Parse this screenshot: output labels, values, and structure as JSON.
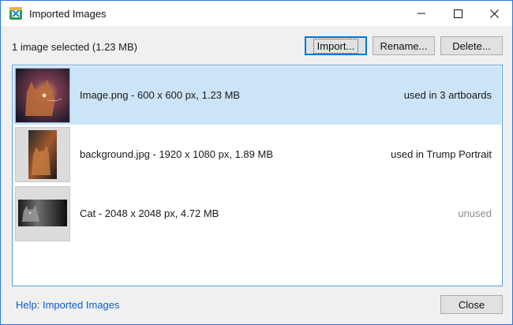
{
  "window": {
    "title": "Imported Images"
  },
  "toolbar": {
    "selection_info": "1 image selected (1.23 MB)",
    "import_label": "Import...",
    "rename_label": "Rename...",
    "delete_label": "Delete..."
  },
  "images": [
    {
      "label": "Image.png - 600 x 600 px, 1.23 MB",
      "usage": "used in 3 artboards",
      "selected": true,
      "thumbnail": "cat-photo-icon"
    },
    {
      "label": "background.jpg - 1920 x 1080 px, 1.89 MB",
      "usage": "used in Trump Portrait",
      "selected": false,
      "thumbnail": "cat-photo-icon"
    },
    {
      "label": "Cat - 2048 x 2048 px, 4.72 MB",
      "usage": "unused",
      "selected": false,
      "thumbnail": "cat-photo-icon"
    }
  ],
  "footer": {
    "help_link": "Help: Imported Images",
    "close_label": "Close"
  },
  "colors": {
    "accent": "#0078d7",
    "selection": "#cce4f7",
    "link": "#0b5bd3",
    "window_border": "#2b79d8"
  }
}
